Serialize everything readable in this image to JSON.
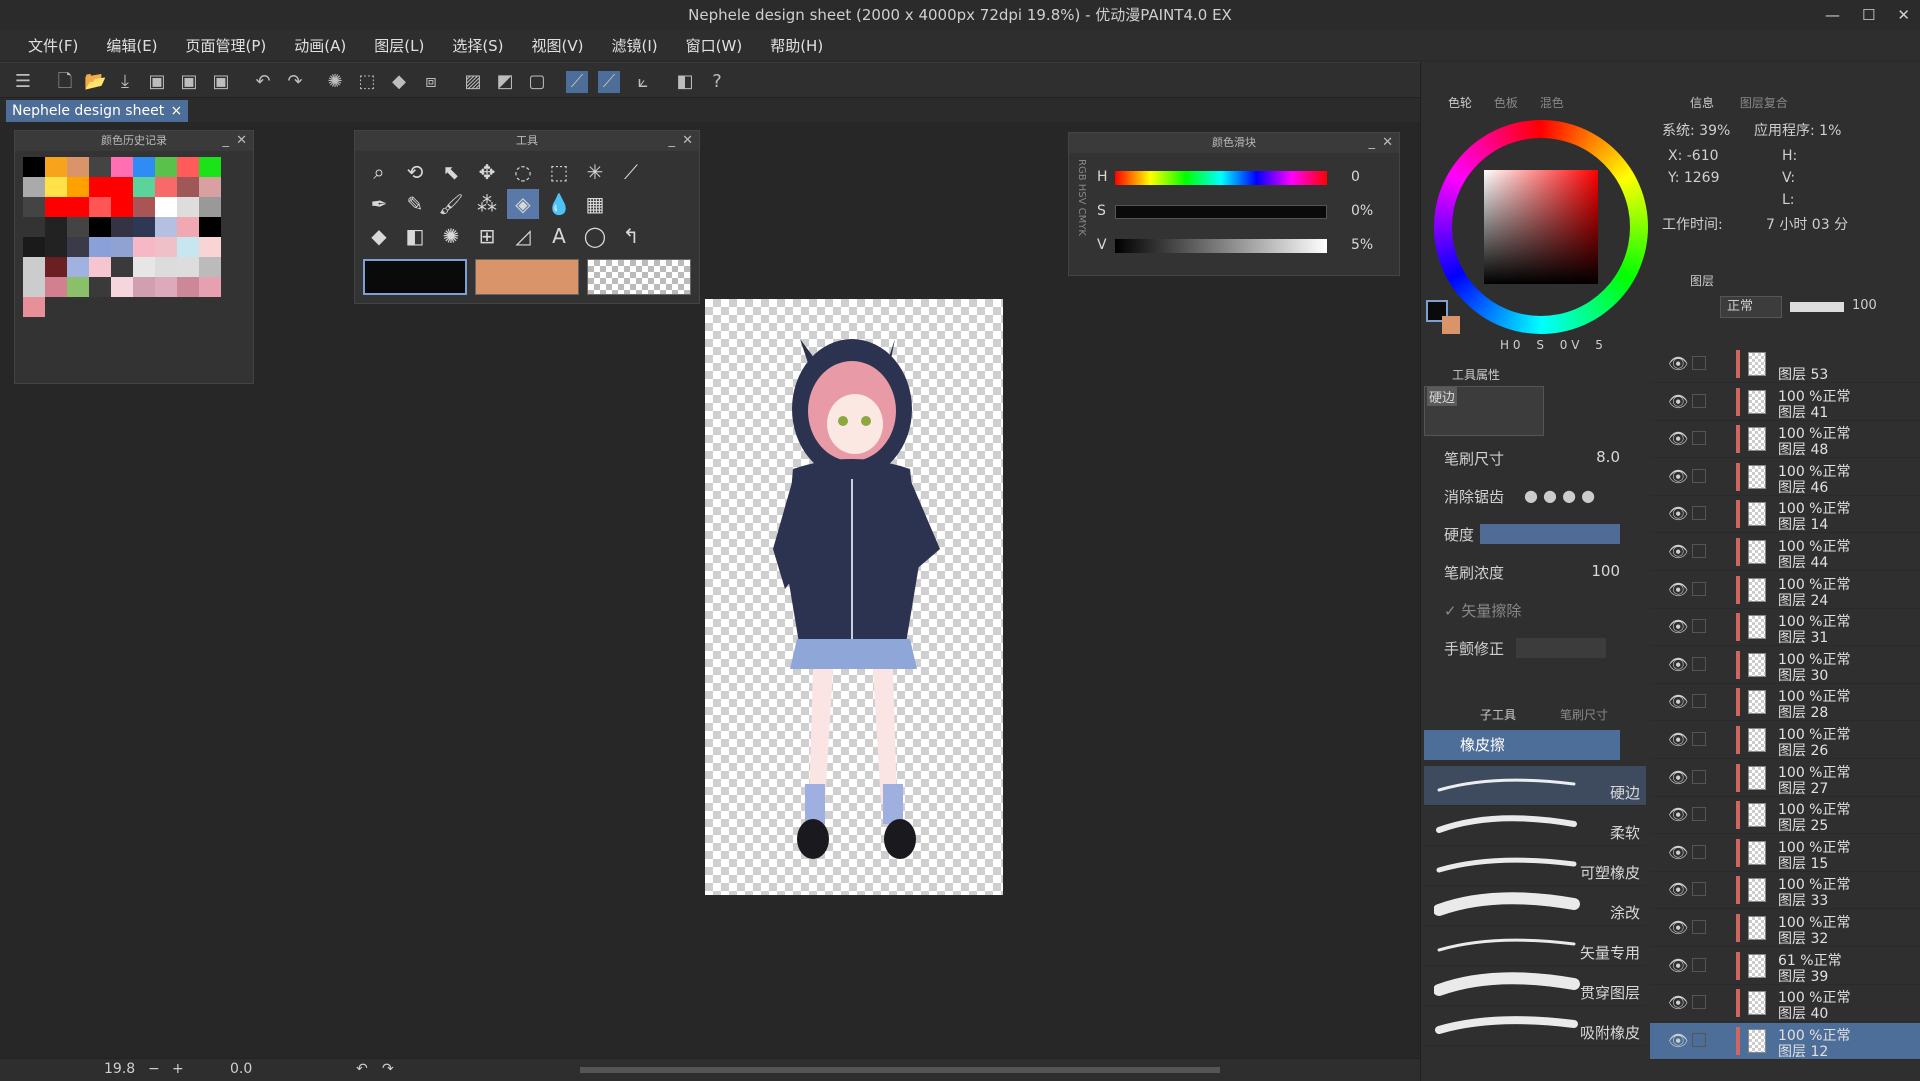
{
  "window": {
    "title": "Nephele design sheet (2000 x 4000px 72dpi 19.8%)  - 优动漫PAINT4.0 EX",
    "min": "—",
    "max": "☐",
    "close": "✕"
  },
  "menu": [
    "文件(F)",
    "编辑(E)",
    "页面管理(P)",
    "动画(A)",
    "图层(L)",
    "选择(S)",
    "视图(V)",
    "滤镜(I)",
    "窗口(W)",
    "帮助(H)"
  ],
  "document_tab": {
    "label": "Nephele design sheet",
    "close": "×"
  },
  "panels": {
    "color_history": {
      "title": "颜色历史记录"
    },
    "tools": {
      "title": "工具"
    },
    "color_slider": {
      "title": "颜色滑块",
      "modes": [
        "RGB",
        "HSV",
        "CMYK"
      ],
      "h_label": "H",
      "h_value": "0",
      "s_label": "S",
      "s_value": "0%",
      "v_label": "V",
      "v_value": "5%"
    },
    "color_wheel": {
      "tab1": "色轮",
      "tab2": "色板",
      "tab3": "混色",
      "h_label": "H",
      "h_value": "0",
      "s_label": "S",
      "v_label": "V",
      "v_value": "0",
      "num_value": "5"
    },
    "info": {
      "tab1": "信息",
      "tab2": "图层复合",
      "system": "系统: 39%",
      "app": "应用程序:  1%",
      "x": "X: -610",
      "y": "Y: 1269",
      "h": "H:",
      "v": "V:",
      "l": "L:",
      "work_time_label": "工作时间:",
      "work_time_value": "7 小时 03 分"
    },
    "layers": {
      "tab": "图层",
      "blend_mode": "正常",
      "opacity": "100"
    },
    "tool_properties": {
      "title": "工具属性",
      "brush_preset": "硬边",
      "brush_size_label": "笔刷尺寸",
      "brush_size_value": "8.0",
      "antialias_label": "消除锯齿",
      "hardness_label": "硬度",
      "density_label": "笔刷浓度",
      "density_value": "100",
      "vector_erase_label": "✓ 矢量擦除",
      "stabilization_label": "手颤修正"
    },
    "sub_tool": {
      "tab1": "子工具",
      "tab2": "笔刷尺寸",
      "group": "橡皮擦",
      "brushes": [
        "硬边",
        "柔软",
        "可塑橡皮",
        "涂改",
        "矢量专用",
        "贯穿图层",
        "吸附橡皮"
      ]
    }
  },
  "layers": [
    {
      "opacity": "",
      "name": "图层 53"
    },
    {
      "opacity": "100 %正常",
      "name": "图层 41"
    },
    {
      "opacity": "100 %正常",
      "name": "图层 48"
    },
    {
      "opacity": "100 %正常",
      "name": "图层 46"
    },
    {
      "opacity": "100 %正常",
      "name": "图层 14"
    },
    {
      "opacity": "100 %正常",
      "name": "图层 44"
    },
    {
      "opacity": "100 %正常",
      "name": "图层 24"
    },
    {
      "opacity": "100 %正常",
      "name": "图层 31"
    },
    {
      "opacity": "100 %正常",
      "name": "图层 30"
    },
    {
      "opacity": "100 %正常",
      "name": "图层 28"
    },
    {
      "opacity": "100 %正常",
      "name": "图层 26"
    },
    {
      "opacity": "100 %正常",
      "name": "图层 27"
    },
    {
      "opacity": "100 %正常",
      "name": "图层 25"
    },
    {
      "opacity": "100 %正常",
      "name": "图层 15"
    },
    {
      "opacity": "100 %正常",
      "name": "图层 33"
    },
    {
      "opacity": "100 %正常",
      "name": "图层 32"
    },
    {
      "opacity": "61 %正常",
      "name": "图层 39"
    },
    {
      "opacity": "100 %正常",
      "name": "图层 40"
    },
    {
      "opacity": "100 %正常",
      "name": "图层 12"
    }
  ],
  "status": {
    "zoom": "19.8",
    "angle": "0.0"
  },
  "colors": {
    "main": "#0a0a0a",
    "sub": "#d9946a",
    "accent": "#5a78a8"
  }
}
